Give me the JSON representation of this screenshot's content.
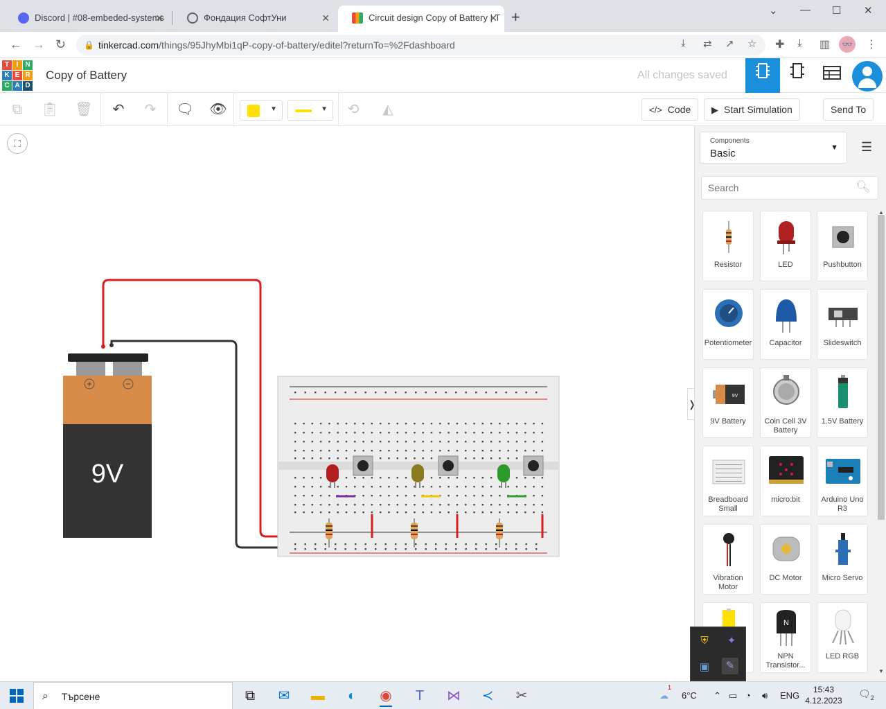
{
  "browser": {
    "tabs": [
      {
        "title": "Discord | #08-embeded-systems",
        "icon": "discord-icon",
        "color": "#5865f2"
      },
      {
        "title": "Фондация СофтУни",
        "icon": "globe-icon",
        "color": "#5f6368"
      },
      {
        "title": "Circuit design Copy of Battery | T",
        "icon": "tinkercad-icon",
        "color": "#e74c3c",
        "active": true
      }
    ],
    "new_tab": "+",
    "window_controls": {
      "chevron": "⌄",
      "minimize": "—",
      "maximize": "☐",
      "close": "✕"
    },
    "url_host": "tinkercad.com",
    "url_path": "/things/95JhyMbi1qP-copy-of-battery/editel?returnTo=%2Fdashboard",
    "profile": "👓"
  },
  "app": {
    "logo_letters": [
      "T",
      "I",
      "N",
      "K",
      "E",
      "R",
      "C",
      "A",
      "D"
    ],
    "logo_colors": [
      "#e74c3c",
      "#f39c12",
      "#27ae60",
      "#2980b9",
      "#e74c3c",
      "#f39c12",
      "#27ae60",
      "#2980b9",
      "#1a5276"
    ],
    "doc_title": "Copy of Battery",
    "save_status": "All changes saved"
  },
  "toolbar": {
    "code_label": "Code",
    "sim_label": "Start Simulation",
    "send_label": "Send To",
    "wire_color": "#ffe000"
  },
  "battery": {
    "label": "9V",
    "plus": "+",
    "minus": "−"
  },
  "panel": {
    "select_label": "Components",
    "select_value": "Basic",
    "search_placeholder": "Search",
    "components": [
      {
        "name": "Resistor"
      },
      {
        "name": "LED"
      },
      {
        "name": "Pushbutton"
      },
      {
        "name": "Potentiometer"
      },
      {
        "name": "Capacitor"
      },
      {
        "name": "Slideswitch"
      },
      {
        "name": "9V Battery"
      },
      {
        "name": "Coin Cell 3V Battery"
      },
      {
        "name": "1.5V Battery"
      },
      {
        "name": "Breadboard Small"
      },
      {
        "name": "micro:bit"
      },
      {
        "name": "Arduino Uno R3"
      },
      {
        "name": "Vibration Motor"
      },
      {
        "name": "DC Motor"
      },
      {
        "name": "Micro Servo"
      },
      {
        "name": ""
      },
      {
        "name": "NPN Transistor..."
      },
      {
        "name": "LED RGB"
      }
    ]
  },
  "taskbar": {
    "search_placeholder": "Търсене",
    "weather": "6°C",
    "lang": "ENG",
    "time": "15:43",
    "date": "4.12.2023 г.",
    "notifications": "2",
    "weather_badge": "1"
  }
}
